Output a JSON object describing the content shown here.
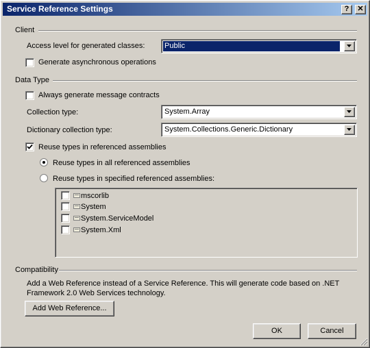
{
  "window": {
    "title": "Service Reference Settings"
  },
  "title_buttons": {
    "help": "?",
    "close": "✕"
  },
  "client": {
    "group_label": "Client",
    "access_level_label": "Access level for generated classes:",
    "access_level_value": "Public",
    "async_label": "Generate asynchronous operations",
    "async_checked": false
  },
  "data_type": {
    "group_label": "Data Type",
    "message_contracts_label": "Always generate message contracts",
    "message_contracts_checked": false,
    "collection_type_label": "Collection type:",
    "collection_type_value": "System.Array",
    "dictionary_type_label": "Dictionary collection type:",
    "dictionary_type_value": "System.Collections.Generic.Dictionary",
    "reuse_types_label": "Reuse types in referenced assemblies",
    "reuse_types_checked": true,
    "reuse_all_label": "Reuse types in all referenced assemblies",
    "reuse_specified_label": "Reuse types in specified referenced assemblies:",
    "selected_option": "all",
    "assemblies": [
      {
        "name": "mscorlib",
        "checked": false
      },
      {
        "name": "System",
        "checked": false
      },
      {
        "name": "System.ServiceModel",
        "checked": false
      },
      {
        "name": "System.Xml",
        "checked": false
      }
    ]
  },
  "compatibility": {
    "group_label": "Compatibility",
    "description_line1": "Add a Web Reference instead of a Service Reference. This will generate code based on .NET",
    "description_line2": "Framework 2.0 Web Services technology.",
    "add_web_reference_label": "Add Web Reference..."
  },
  "footer": {
    "ok_label": "OK",
    "cancel_label": "Cancel"
  },
  "icons": {
    "help": "question-mark-icon",
    "close": "close-icon",
    "dropdown": "triangle-down-icon",
    "assembly": "assembly-icon",
    "checkmark": "checkmark-icon",
    "resize": "resize-grip-icon"
  },
  "colors": {
    "title_gradient_start": "#0a246a",
    "title_gradient_end": "#a6caf0",
    "face": "#d4d0c8",
    "selection": "#0a246a"
  }
}
